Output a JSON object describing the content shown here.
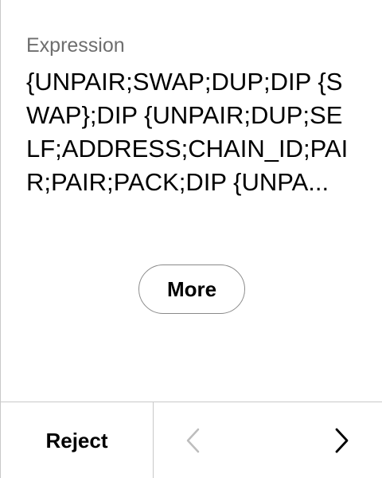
{
  "field": {
    "label": "Expression",
    "value": "{UNPAIR;SWAP;DUP;DIP {SWAP};DIP {UNPAIR;DUP;SELF;ADDRESS;CHAIN_ID;PAIR;PAIR;PACK;DIP {UNPA..."
  },
  "more_button": {
    "label": "More"
  },
  "footer": {
    "reject_label": "Reject",
    "prev_icon": "chevron-left-icon",
    "next_icon": "chevron-right-icon",
    "prev_color": "#bdbdbd",
    "next_color": "#000000"
  }
}
